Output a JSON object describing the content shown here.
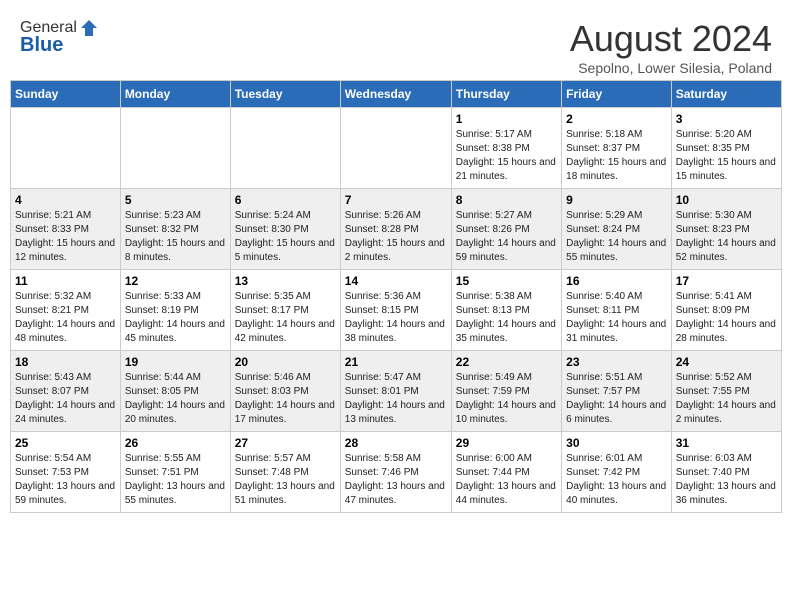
{
  "header": {
    "logo_general": "General",
    "logo_blue": "Blue",
    "month_title": "August 2024",
    "location": "Sepolno, Lower Silesia, Poland"
  },
  "days_of_week": [
    "Sunday",
    "Monday",
    "Tuesday",
    "Wednesday",
    "Thursday",
    "Friday",
    "Saturday"
  ],
  "weeks": [
    [
      {
        "day": "",
        "info": ""
      },
      {
        "day": "",
        "info": ""
      },
      {
        "day": "",
        "info": ""
      },
      {
        "day": "",
        "info": ""
      },
      {
        "day": "1",
        "info": "Sunrise: 5:17 AM\nSunset: 8:38 PM\nDaylight: 15 hours\nand 21 minutes."
      },
      {
        "day": "2",
        "info": "Sunrise: 5:18 AM\nSunset: 8:37 PM\nDaylight: 15 hours\nand 18 minutes."
      },
      {
        "day": "3",
        "info": "Sunrise: 5:20 AM\nSunset: 8:35 PM\nDaylight: 15 hours\nand 15 minutes."
      }
    ],
    [
      {
        "day": "4",
        "info": "Sunrise: 5:21 AM\nSunset: 8:33 PM\nDaylight: 15 hours\nand 12 minutes."
      },
      {
        "day": "5",
        "info": "Sunrise: 5:23 AM\nSunset: 8:32 PM\nDaylight: 15 hours\nand 8 minutes."
      },
      {
        "day": "6",
        "info": "Sunrise: 5:24 AM\nSunset: 8:30 PM\nDaylight: 15 hours\nand 5 minutes."
      },
      {
        "day": "7",
        "info": "Sunrise: 5:26 AM\nSunset: 8:28 PM\nDaylight: 15 hours\nand 2 minutes."
      },
      {
        "day": "8",
        "info": "Sunrise: 5:27 AM\nSunset: 8:26 PM\nDaylight: 14 hours\nand 59 minutes."
      },
      {
        "day": "9",
        "info": "Sunrise: 5:29 AM\nSunset: 8:24 PM\nDaylight: 14 hours\nand 55 minutes."
      },
      {
        "day": "10",
        "info": "Sunrise: 5:30 AM\nSunset: 8:23 PM\nDaylight: 14 hours\nand 52 minutes."
      }
    ],
    [
      {
        "day": "11",
        "info": "Sunrise: 5:32 AM\nSunset: 8:21 PM\nDaylight: 14 hours\nand 48 minutes."
      },
      {
        "day": "12",
        "info": "Sunrise: 5:33 AM\nSunset: 8:19 PM\nDaylight: 14 hours\nand 45 minutes."
      },
      {
        "day": "13",
        "info": "Sunrise: 5:35 AM\nSunset: 8:17 PM\nDaylight: 14 hours\nand 42 minutes."
      },
      {
        "day": "14",
        "info": "Sunrise: 5:36 AM\nSunset: 8:15 PM\nDaylight: 14 hours\nand 38 minutes."
      },
      {
        "day": "15",
        "info": "Sunrise: 5:38 AM\nSunset: 8:13 PM\nDaylight: 14 hours\nand 35 minutes."
      },
      {
        "day": "16",
        "info": "Sunrise: 5:40 AM\nSunset: 8:11 PM\nDaylight: 14 hours\nand 31 minutes."
      },
      {
        "day": "17",
        "info": "Sunrise: 5:41 AM\nSunset: 8:09 PM\nDaylight: 14 hours\nand 28 minutes."
      }
    ],
    [
      {
        "day": "18",
        "info": "Sunrise: 5:43 AM\nSunset: 8:07 PM\nDaylight: 14 hours\nand 24 minutes."
      },
      {
        "day": "19",
        "info": "Sunrise: 5:44 AM\nSunset: 8:05 PM\nDaylight: 14 hours\nand 20 minutes."
      },
      {
        "day": "20",
        "info": "Sunrise: 5:46 AM\nSunset: 8:03 PM\nDaylight: 14 hours\nand 17 minutes."
      },
      {
        "day": "21",
        "info": "Sunrise: 5:47 AM\nSunset: 8:01 PM\nDaylight: 14 hours\nand 13 minutes."
      },
      {
        "day": "22",
        "info": "Sunrise: 5:49 AM\nSunset: 7:59 PM\nDaylight: 14 hours\nand 10 minutes."
      },
      {
        "day": "23",
        "info": "Sunrise: 5:51 AM\nSunset: 7:57 PM\nDaylight: 14 hours\nand 6 minutes."
      },
      {
        "day": "24",
        "info": "Sunrise: 5:52 AM\nSunset: 7:55 PM\nDaylight: 14 hours\nand 2 minutes."
      }
    ],
    [
      {
        "day": "25",
        "info": "Sunrise: 5:54 AM\nSunset: 7:53 PM\nDaylight: 13 hours\nand 59 minutes."
      },
      {
        "day": "26",
        "info": "Sunrise: 5:55 AM\nSunset: 7:51 PM\nDaylight: 13 hours\nand 55 minutes."
      },
      {
        "day": "27",
        "info": "Sunrise: 5:57 AM\nSunset: 7:48 PM\nDaylight: 13 hours\nand 51 minutes."
      },
      {
        "day": "28",
        "info": "Sunrise: 5:58 AM\nSunset: 7:46 PM\nDaylight: 13 hours\nand 47 minutes."
      },
      {
        "day": "29",
        "info": "Sunrise: 6:00 AM\nSunset: 7:44 PM\nDaylight: 13 hours\nand 44 minutes."
      },
      {
        "day": "30",
        "info": "Sunrise: 6:01 AM\nSunset: 7:42 PM\nDaylight: 13 hours\nand 40 minutes."
      },
      {
        "day": "31",
        "info": "Sunrise: 6:03 AM\nSunset: 7:40 PM\nDaylight: 13 hours\nand 36 minutes."
      }
    ]
  ]
}
